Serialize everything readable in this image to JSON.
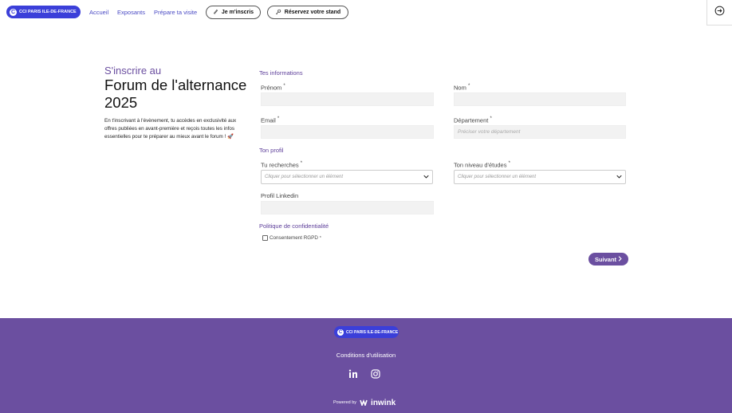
{
  "header": {
    "logo_text": "CCI PARIS ILE-DE-FRANCE",
    "logo_letter": "C",
    "nav": [
      "Accueil",
      "Exposants",
      "Prépare ta visite"
    ],
    "register_label": "Je m'inscris",
    "stand_label": "Réservez votre stand"
  },
  "intro": {
    "small_title": "S'inscrire au",
    "big_title": "Forum de l'alternance 2025",
    "text": "En t'inscrivant à l'évènement, tu accèdes en exclusivité aux offres publiées en avant-première et reçois toutes les infos essentielles pour te préparer au mieux avant le forum ! 🚀"
  },
  "form": {
    "section_info": "Tes informations",
    "prenom_label": "Prénom",
    "nom_label": "Nom",
    "email_label": "Email",
    "departement_label": "Département",
    "departement_placeholder": "Préciser votre département",
    "section_profile": "Ton profil",
    "recherche_label": "Tu recherches",
    "recherche_placeholder": "Cliquer pour sélectionner un élément",
    "niveau_label": "Ton niveau d'études",
    "niveau_placeholder": "Cliquer pour sélectionner un élément",
    "linkedin_label": "Profil Linkedin",
    "section_privacy": "Politique de confidentialité",
    "consent_label": "Consentement RGPD",
    "required_mark": "*",
    "next_label": "Suivant"
  },
  "footer": {
    "logo_text": "CCI PARIS ILE-DE-FRANCE",
    "logo_letter": "C",
    "terms": "Conditions d'utilisation",
    "powered_by": "Powered by",
    "brand": "inwink",
    "social": [
      "linkedin-icon",
      "instagram-icon"
    ]
  },
  "colors": {
    "accent": "#6b4fa0",
    "logo_blue": "#3b3fd9"
  }
}
